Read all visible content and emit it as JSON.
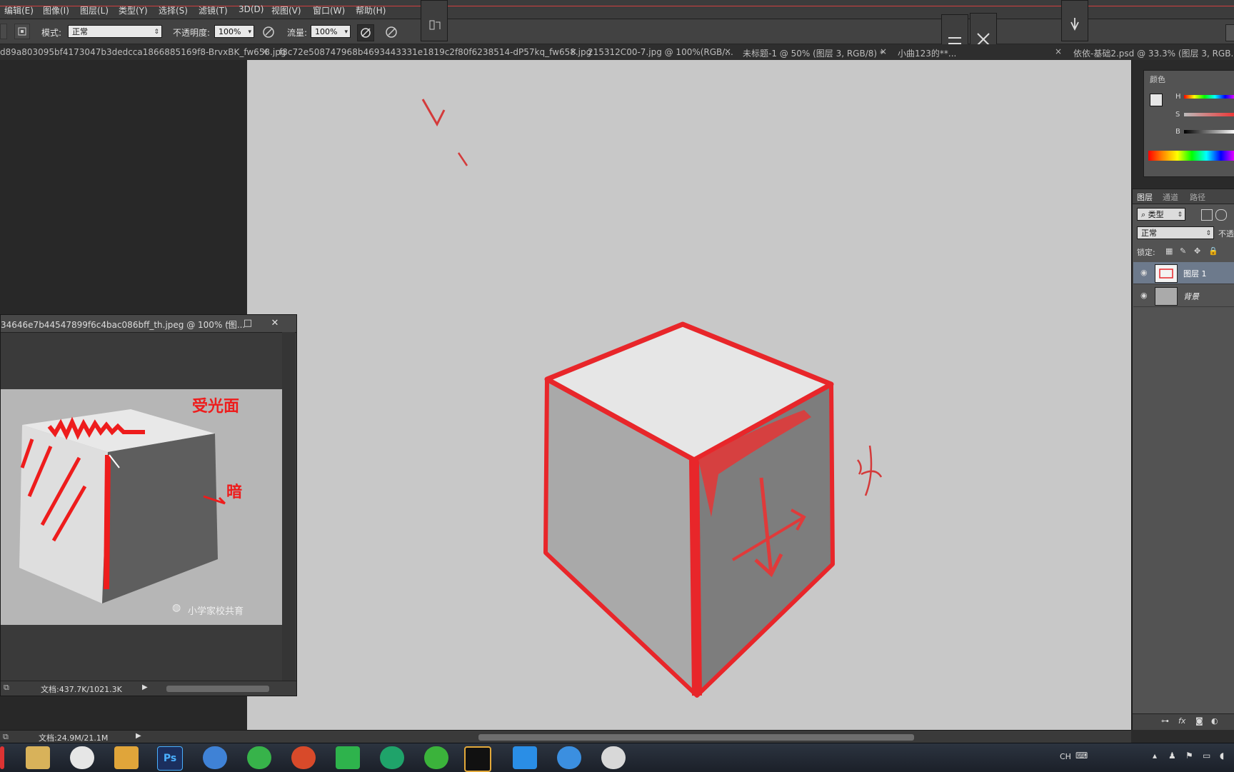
{
  "menu": [
    "编辑(E)",
    "图像(I)",
    "图层(L)",
    "类型(Y)",
    "选择(S)",
    "滤镜(T)",
    "3D(D)",
    "视图(V)",
    "窗口(W)",
    "帮助(H)"
  ],
  "options": {
    "mode_label": "模式:",
    "mode_value": "正常",
    "opacity_label": "不透明度:",
    "opacity_value": "100%",
    "flow_label": "流量:",
    "flow_value": "100%"
  },
  "tabs": [
    "d89a803095bf4173047b3dedcca1866885169f8-BrvxBK_fw658.jpg",
    "f8c72e508747968b4693443331e1819c2f80f6238514-dP57kq_fw658.jpg",
    "215312C00-7.jpg @ 100%(RGB/...",
    "未标题-1 @ 50% (图层 3, RGB/8) *",
    "小曲123的**...",
    "依依-基础2.psd @ 33.3% (图层 3, RGB..."
  ],
  "color_panel": {
    "tab": "颜色",
    "h": "H",
    "s": "S",
    "b": "B"
  },
  "layers_panel": {
    "tabs": [
      "图层",
      "通道",
      "路径"
    ],
    "filter": "类型",
    "blend": "正常",
    "opacity_label": "不透",
    "lock_label": "锁定:",
    "layers": [
      {
        "name": "图层 1",
        "selected": true
      },
      {
        "name": "背景",
        "selected": false
      }
    ]
  },
  "float_window": {
    "title": "34646e7b44547899f6c4bac086bff_th.jpeg @ 100% (图...",
    "status": "文档:437.7K/1021.3K",
    "watermark": "小学家校共育",
    "annotation_top": "受光面",
    "annotation_dark": "暗"
  },
  "canvas": {
    "annotation_right": "渗"
  },
  "statusbar": {
    "doc": "文档:24.9M/21.1M"
  },
  "tray": {
    "lang": "CH"
  },
  "colors": {
    "accent_red": "#e8262a",
    "canvas_bg": "#c8c8c8"
  }
}
